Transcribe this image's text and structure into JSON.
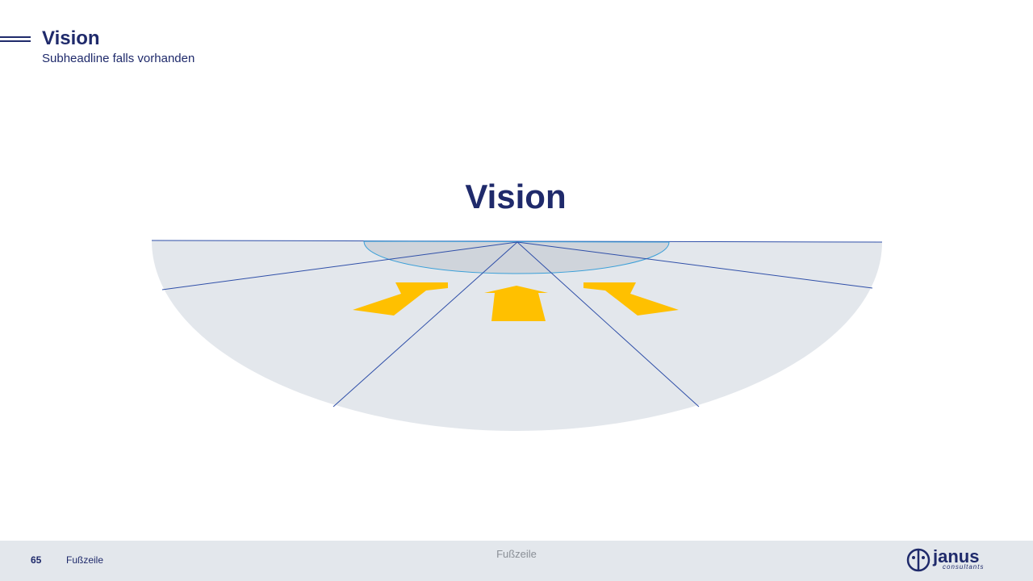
{
  "header": {
    "title": "Vision",
    "subtitle": "Subheadline falls vorhanden"
  },
  "diagram": {
    "heading": "Vision",
    "colors": {
      "field": "#e3e7ec",
      "center_ellipse": "#cfd4db",
      "center_ellipse_border": "#3a9fd8",
      "lines": "#2f4fa8",
      "arrows": "#ffc000",
      "heading": "#1f2a6b"
    },
    "arrows": [
      {
        "direction": "up-right"
      },
      {
        "direction": "up"
      },
      {
        "direction": "up-left"
      }
    ]
  },
  "footer": {
    "page_number": "65",
    "left_text": "Fußzeile",
    "center_text": "Fußzeile",
    "logo": {
      "name": "janus",
      "tagline": "consultants"
    }
  }
}
